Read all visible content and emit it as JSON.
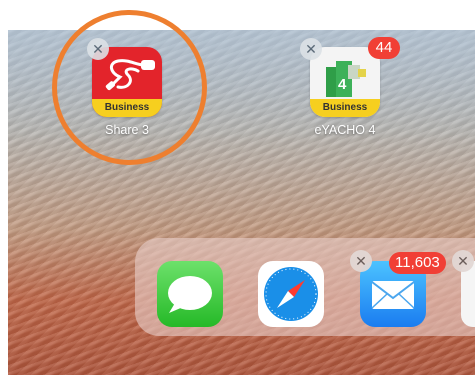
{
  "apps": [
    {
      "name": "Share 3",
      "band": "Business",
      "delete": "✕"
    },
    {
      "name": "eYACHO 4",
      "band": "Business",
      "delete": "✕",
      "badge": "44",
      "digit": "4"
    }
  ],
  "dock": {
    "mail_badge": "11,603",
    "delete": "✕"
  },
  "colors": {
    "highlight": "#ee7f2f",
    "badge": "#f13f35",
    "share_red": "#e3242b",
    "business_yellow": "#f6cf1f"
  },
  "icons": [
    "close-icon",
    "cable-icon",
    "chart-icon",
    "messages-icon",
    "compass-icon",
    "envelope-icon"
  ]
}
